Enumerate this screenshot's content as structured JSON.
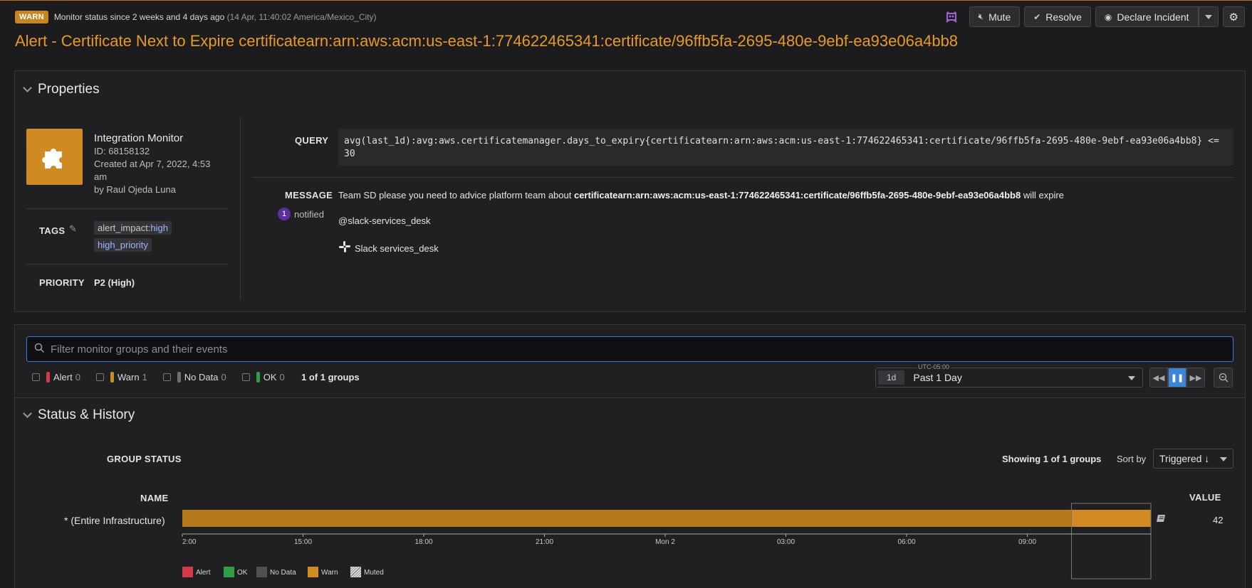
{
  "header": {
    "status_badge": "WARN",
    "status_since": "Monitor status since 2 weeks and 4 days ago",
    "status_tz": "(14 Apr, 11:40:02 America/Mexico_City)",
    "title": "Alert - Certificate Next to Expire certificatearn:arn:aws:acm:us-east-1:774622465341:certificate/96ffb5fa-2695-480e-9ebf-ea93e06a4bb8",
    "actions": {
      "mute": "Mute",
      "resolve": "Resolve",
      "declare": "Declare Incident"
    }
  },
  "properties": {
    "section_title": "Properties",
    "monitor": {
      "name": "Integration Monitor",
      "id": "ID: 68158132",
      "created": "Created at Apr 7, 2022, 4:53 am",
      "by": "by Raul Ojeda Luna"
    },
    "tags_label": "TAGS",
    "tags": [
      {
        "key": "alert_impact:",
        "value": "high"
      },
      {
        "key": "",
        "value": "high_priority"
      }
    ],
    "priority_label": "PRIORITY",
    "priority_value": "P2 (High)",
    "query_label": "QUERY",
    "query": "avg(last_1d):avg:aws.certificatemanager.days_to_expiry{certificatearn:arn:aws:acm:us-east-1:774622465341:certificate/96ffb5fa-2695-480e-9ebf-ea93e06a4bb8} <= 30",
    "message_label": "MESSAGE",
    "message_prefix": "Team SD please you need to advice platform team about ",
    "message_bold": "certificatearn:arn:aws:acm:us-east-1:774622465341:certificate/96ffb5fa-2695-480e-9ebf-ea93e06a4bb8",
    "message_suffix": " will expire",
    "notified_count": "1",
    "notified_label": "notified",
    "handle": "@slack-services_desk",
    "slack_channel": "Slack services_desk"
  },
  "filter": {
    "placeholder": "Filter monitor groups and their events",
    "statuses": [
      {
        "label": "Alert",
        "count": "0",
        "color": "#d43a4a"
      },
      {
        "label": "Warn",
        "count": "1",
        "color": "#d08b20"
      },
      {
        "label": "No Data",
        "count": "0",
        "color": "#6e6e6e"
      },
      {
        "label": "OK",
        "count": "0",
        "color": "#2f9e49"
      }
    ],
    "groups_count": "1 of 1 groups",
    "timezone": "UTC-05:00",
    "time_pill": "1d",
    "time_label": "Past 1 Day"
  },
  "history": {
    "section_title": "Status & History",
    "group_status_label": "GROUP STATUS",
    "showing": "Showing 1 of 1 groups",
    "sort_by_label": "Sort by",
    "sort_value": "Triggered ↓",
    "name_label": "NAME",
    "value_label": "VALUE",
    "rows": [
      {
        "name": "* (Entire Infrastructure)",
        "value": "42"
      }
    ],
    "colors": {
      "warn": "#b57a1c",
      "warn_selected": "#d28a22",
      "alert": "#d43a4a",
      "ok": "#2f9e49",
      "nodata": "#505054"
    }
  },
  "chart_data": {
    "type": "bar",
    "x_ticks": [
      "2:00",
      "15:00",
      "18:00",
      "21:00",
      "Mon 2",
      "03:00",
      "06:00",
      "09:00"
    ],
    "segments": [
      {
        "status": "Warn",
        "start_tick_index": 0,
        "end_fraction": 0.918
      }
    ],
    "selected_range_fraction": [
      0.918,
      1.0
    ],
    "legend": [
      "Alert",
      "OK",
      "No Data",
      "Warn",
      "Muted"
    ]
  }
}
